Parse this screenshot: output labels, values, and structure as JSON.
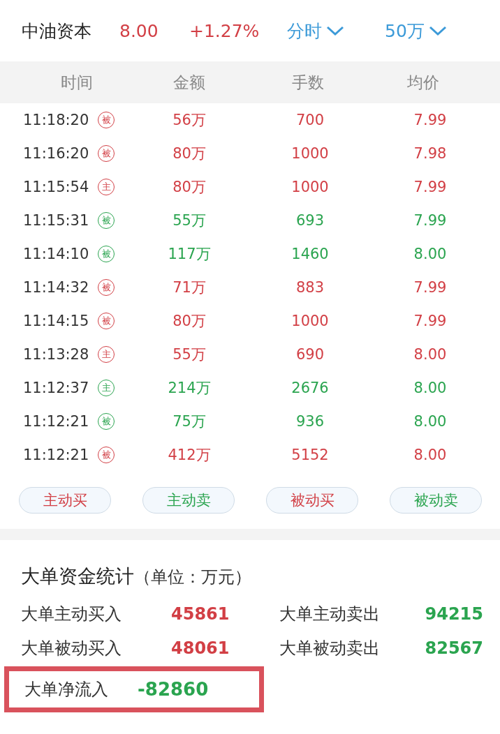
{
  "header": {
    "name": "中油资本",
    "price": "8.00",
    "change": "+1.27%",
    "period": "分时",
    "threshold": "50万"
  },
  "table": {
    "columns": [
      "时间",
      "金额",
      "手数",
      "均价"
    ],
    "rows": [
      {
        "time": "11:18:20",
        "tag": "被",
        "amount": "56万",
        "lots": "700",
        "avg": "7.99",
        "color": "#d23f45"
      },
      {
        "time": "11:16:20",
        "tag": "被",
        "amount": "80万",
        "lots": "1000",
        "avg": "7.98",
        "color": "#d23f45"
      },
      {
        "time": "11:15:54",
        "tag": "主",
        "amount": "80万",
        "lots": "1000",
        "avg": "7.99",
        "color": "#d23f45"
      },
      {
        "time": "11:15:31",
        "tag": "被",
        "amount": "55万",
        "lots": "693",
        "avg": "7.99",
        "color": "#2aa44f"
      },
      {
        "time": "11:14:10",
        "tag": "被",
        "amount": "117万",
        "lots": "1460",
        "avg": "8.00",
        "color": "#2aa44f"
      },
      {
        "time": "11:14:32",
        "tag": "被",
        "amount": "71万",
        "lots": "883",
        "avg": "7.99",
        "color": "#d23f45"
      },
      {
        "time": "11:14:15",
        "tag": "被",
        "amount": "80万",
        "lots": "1000",
        "avg": "7.99",
        "color": "#d23f45"
      },
      {
        "time": "11:13:28",
        "tag": "主",
        "amount": "55万",
        "lots": "690",
        "avg": "8.00",
        "color": "#d23f45"
      },
      {
        "time": "11:12:37",
        "tag": "主",
        "amount": "214万",
        "lots": "2676",
        "avg": "8.00",
        "color": "#2aa44f"
      },
      {
        "time": "11:12:21",
        "tag": "被",
        "amount": "75万",
        "lots": "936",
        "avg": "8.00",
        "color": "#2aa44f"
      },
      {
        "time": "11:12:21",
        "tag": "被",
        "amount": "412万",
        "lots": "5152",
        "avg": "8.00",
        "color": "#d23f45"
      }
    ]
  },
  "filters": [
    {
      "label": "主动买",
      "color": "#d23f45"
    },
    {
      "label": "主动卖",
      "color": "#2aa44f"
    },
    {
      "label": "被动买",
      "color": "#d23f45"
    },
    {
      "label": "被动卖",
      "color": "#2aa44f"
    }
  ],
  "stats": {
    "title": "大单资金统计",
    "unit": "（单位：万元）",
    "items": [
      {
        "label": "大单主动买入",
        "value": "45861",
        "color": "#d23f45"
      },
      {
        "label": "大单主动卖出",
        "value": "94215",
        "color": "#2aa44f"
      },
      {
        "label": "大单被动买入",
        "value": "48061",
        "color": "#d23f45"
      },
      {
        "label": "大单被动卖出",
        "value": "82567",
        "color": "#2aa44f"
      }
    ],
    "net": {
      "label": "大单净流入",
      "value": "-82860",
      "color": "#2aa44f",
      "highlighted": true
    }
  }
}
